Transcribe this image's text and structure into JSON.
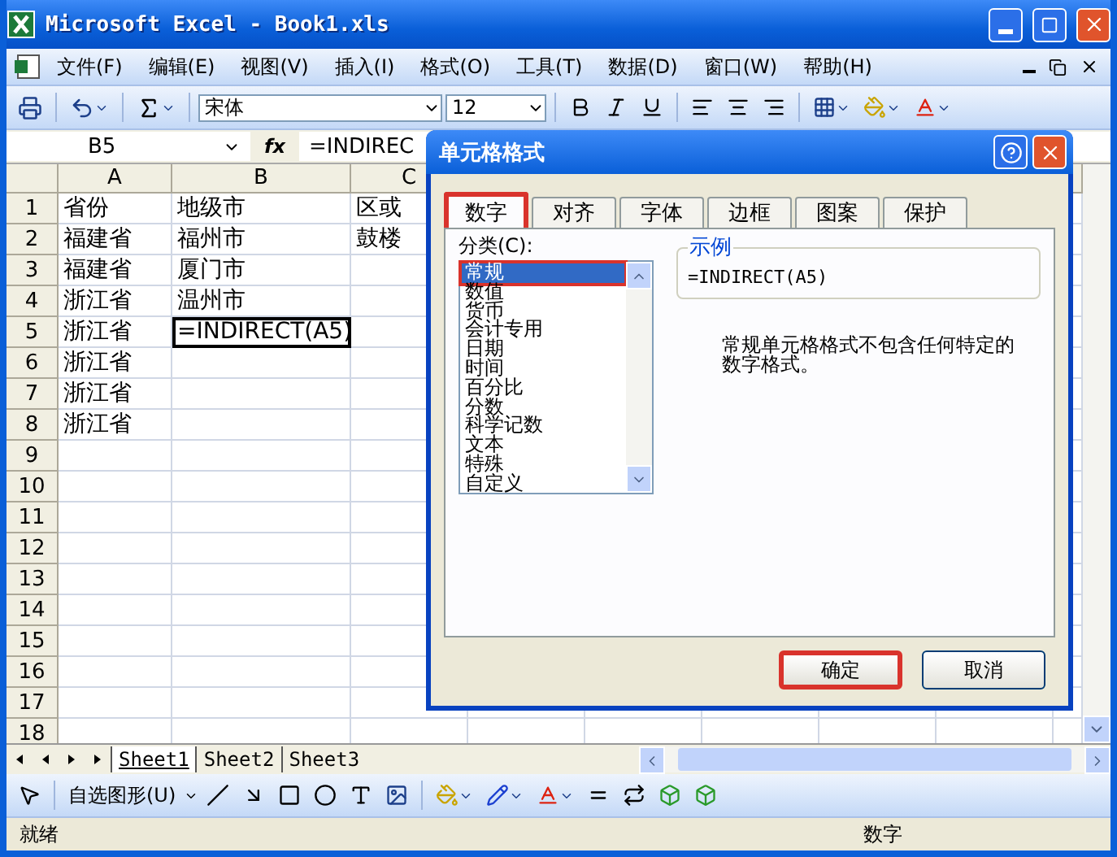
{
  "window": {
    "title": "Microsoft Excel - Book1.xls"
  },
  "menu": [
    "文件(F)",
    "编辑(E)",
    "视图(V)",
    "插入(I)",
    "格式(O)",
    "工具(T)",
    "数据(D)",
    "窗口(W)",
    "帮助(H)"
  ],
  "format_toolbar": {
    "font": "宋体",
    "size": "12"
  },
  "formula_bar": {
    "name_box": "B5",
    "fx": "fx",
    "formula": "=INDIREC"
  },
  "sheet": {
    "columns": [
      "A",
      "B",
      "C"
    ],
    "rows": [
      {
        "number": "1",
        "cells": [
          {
            "text": "省份",
            "selected": false
          },
          {
            "text": "地级市",
            "selected": false
          },
          {
            "text": "区或",
            "selected": false
          }
        ]
      },
      {
        "number": "2",
        "cells": [
          {
            "text": "福建省",
            "selected": false
          },
          {
            "text": "福州市",
            "selected": false
          },
          {
            "text": "鼓楼",
            "selected": false
          }
        ]
      },
      {
        "number": "3",
        "cells": [
          {
            "text": "福建省",
            "selected": false
          },
          {
            "text": "厦门市",
            "selected": false
          }
        ]
      },
      {
        "number": "4",
        "cells": [
          {
            "text": "浙江省",
            "selected": false
          },
          {
            "text": "温州市",
            "selected": false
          }
        ]
      },
      {
        "number": "5",
        "cells": [
          {
            "text": "浙江省",
            "selected": false
          },
          {
            "text": "=INDIRECT(A5)",
            "selected": true
          }
        ]
      },
      {
        "number": "6",
        "cells": [
          {
            "text": "浙江省",
            "selected": false
          }
        ]
      },
      {
        "number": "7",
        "cells": [
          {
            "text": "浙江省",
            "selected": false
          }
        ]
      },
      {
        "number": "8",
        "cells": [
          {
            "text": "浙江省",
            "selected": false
          }
        ]
      },
      {
        "number": "9"
      },
      {
        "number": "10"
      },
      {
        "number": "11"
      },
      {
        "number": "12"
      },
      {
        "number": "13"
      },
      {
        "number": "14"
      },
      {
        "number": "15"
      },
      {
        "number": "16"
      },
      {
        "number": "17"
      },
      {
        "number": "18"
      }
    ]
  },
  "sheet_tabs": [
    {
      "label": "Sheet1",
      "selected": true
    },
    {
      "label": "Sheet2",
      "selected": false
    },
    {
      "label": "Sheet3",
      "selected": false
    }
  ],
  "drawing_toolbar": {
    "autoshapes": "自选图形(U)"
  },
  "status_bar": {
    "left": "就绪",
    "mode": "数字"
  },
  "dialog": {
    "title": "单元格格式",
    "tabs": [
      {
        "label": "数字",
        "selected": true,
        "highlighted": true
      },
      {
        "label": "对齐",
        "selected": false,
        "highlighted": false
      },
      {
        "label": "字体",
        "selected": false,
        "highlighted": false
      },
      {
        "label": "边框",
        "selected": false,
        "highlighted": false
      },
      {
        "label": "图案",
        "selected": false,
        "highlighted": false
      },
      {
        "label": "保护",
        "selected": false,
        "highlighted": false
      }
    ],
    "category_label": "分类(C):",
    "categories": [
      {
        "label": "常规",
        "selected": true,
        "highlighted": true
      },
      {
        "label": "数值",
        "selected": false,
        "highlighted": false
      },
      {
        "label": "货币",
        "selected": false,
        "highlighted": false
      },
      {
        "label": "会计专用",
        "selected": false,
        "highlighted": false
      },
      {
        "label": "日期",
        "selected": false,
        "highlighted": false
      },
      {
        "label": "时间",
        "selected": false,
        "highlighted": false
      },
      {
        "label": "百分比",
        "selected": false,
        "highlighted": false
      },
      {
        "label": "分数",
        "selected": false,
        "highlighted": false
      },
      {
        "label": "科学记数",
        "selected": false,
        "highlighted": false
      },
      {
        "label": "文本",
        "selected": false,
        "highlighted": false
      },
      {
        "label": "特殊",
        "selected": false,
        "highlighted": false
      },
      {
        "label": "自定义",
        "selected": false,
        "highlighted": false
      }
    ],
    "sample_label": "示例",
    "sample_value": "=INDIRECT(A5)",
    "description": "常规单元格格式不包含任何特定的数字格式。",
    "buttons": [
      {
        "label": "确定",
        "highlighted": true
      },
      {
        "label": "取消",
        "highlighted": false
      }
    ]
  }
}
